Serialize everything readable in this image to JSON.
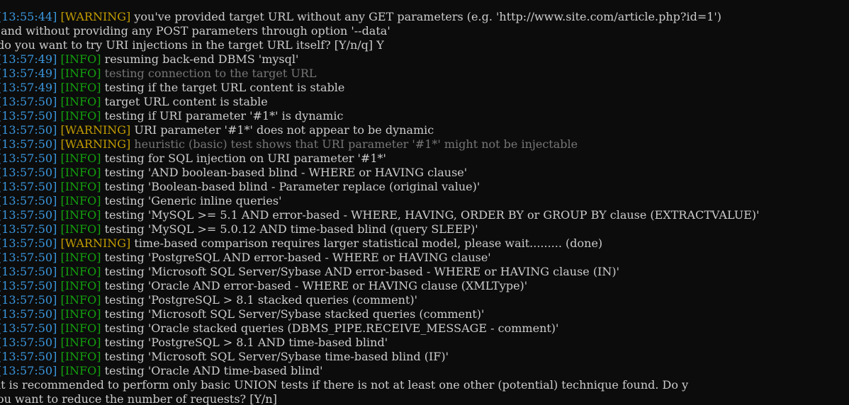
{
  "terminal": {
    "lines": [
      {
        "type": "log",
        "ts": "13:55:44",
        "level": "WARNING",
        "msg": "you've provided target URL without any GET parameters (e.g. 'http://www.site.com/article.php?id=1')",
        "dim": false
      },
      {
        "type": "plain",
        "text": " and without providing any POST parameters through option '--data'"
      },
      {
        "type": "plain",
        "text": "do you want to try URI injections in the target URL itself? [Y/n/q] Y"
      },
      {
        "type": "log",
        "ts": "13:57:49",
        "level": "INFO",
        "msg": "resuming back-end DBMS 'mysql'",
        "dim": false
      },
      {
        "type": "log",
        "ts": "13:57:49",
        "level": "INFO",
        "msg": "testing connection to the target URL",
        "dim": true
      },
      {
        "type": "log",
        "ts": "13:57:49",
        "level": "INFO",
        "msg": "testing if the target URL content is stable",
        "dim": false
      },
      {
        "type": "log",
        "ts": "13:57:50",
        "level": "INFO",
        "msg": "target URL content is stable",
        "dim": false
      },
      {
        "type": "log",
        "ts": "13:57:50",
        "level": "INFO",
        "msg": "testing if URI parameter '#1*' is dynamic",
        "dim": false
      },
      {
        "type": "log",
        "ts": "13:57:50",
        "level": "WARNING",
        "msg": "URI parameter '#1*' does not appear to be dynamic",
        "dim": false
      },
      {
        "type": "log",
        "ts": "13:57:50",
        "level": "WARNING",
        "msg": "heuristic (basic) test shows that URI parameter '#1*' might not be injectable",
        "dim": true
      },
      {
        "type": "log",
        "ts": "13:57:50",
        "level": "INFO",
        "msg": "testing for SQL injection on URI parameter '#1*'",
        "dim": false
      },
      {
        "type": "log",
        "ts": "13:57:50",
        "level": "INFO",
        "msg": "testing 'AND boolean-based blind - WHERE or HAVING clause'",
        "dim": false
      },
      {
        "type": "log",
        "ts": "13:57:50",
        "level": "INFO",
        "msg": "testing 'Boolean-based blind - Parameter replace (original value)'",
        "dim": false
      },
      {
        "type": "log",
        "ts": "13:57:50",
        "level": "INFO",
        "msg": "testing 'Generic inline queries'",
        "dim": false
      },
      {
        "type": "log",
        "ts": "13:57:50",
        "level": "INFO",
        "msg": "testing 'MySQL >= 5.1 AND error-based - WHERE, HAVING, ORDER BY or GROUP BY clause (EXTRACTVALUE)'",
        "dim": false
      },
      {
        "type": "log",
        "ts": "13:57:50",
        "level": "INFO",
        "msg": "testing 'MySQL >= 5.0.12 AND time-based blind (query SLEEP)'",
        "dim": false
      },
      {
        "type": "log",
        "ts": "13:57:50",
        "level": "WARNING",
        "msg": "time-based comparison requires larger statistical model, please wait......... (done)",
        "dim": false
      },
      {
        "type": "log",
        "ts": "13:57:50",
        "level": "INFO",
        "msg": "testing 'PostgreSQL AND error-based - WHERE or HAVING clause'",
        "dim": false
      },
      {
        "type": "log",
        "ts": "13:57:50",
        "level": "INFO",
        "msg": "testing 'Microsoft SQL Server/Sybase AND error-based - WHERE or HAVING clause (IN)'",
        "dim": false
      },
      {
        "type": "log",
        "ts": "13:57:50",
        "level": "INFO",
        "msg": "testing 'Oracle AND error-based - WHERE or HAVING clause (XMLType)'",
        "dim": false
      },
      {
        "type": "log",
        "ts": "13:57:50",
        "level": "INFO",
        "msg": "testing 'PostgreSQL > 8.1 stacked queries (comment)'",
        "dim": false
      },
      {
        "type": "log",
        "ts": "13:57:50",
        "level": "INFO",
        "msg": "testing 'Microsoft SQL Server/Sybase stacked queries (comment)'",
        "dim": false
      },
      {
        "type": "log",
        "ts": "13:57:50",
        "level": "INFO",
        "msg": "testing 'Oracle stacked queries (DBMS_PIPE.RECEIVE_MESSAGE - comment)'",
        "dim": false
      },
      {
        "type": "log",
        "ts": "13:57:50",
        "level": "INFO",
        "msg": "testing 'PostgreSQL > 8.1 AND time-based blind'",
        "dim": false
      },
      {
        "type": "log",
        "ts": "13:57:50",
        "level": "INFO",
        "msg": "testing 'Microsoft SQL Server/Sybase time-based blind (IF)'",
        "dim": false
      },
      {
        "type": "log",
        "ts": "13:57:50",
        "level": "INFO",
        "msg": "testing 'Oracle AND time-based blind'",
        "dim": false
      },
      {
        "type": "plain",
        "text": "it is recommended to perform only basic UNION tests if there is not at least one other (potential) technique found. Do y"
      },
      {
        "type": "plain",
        "text": "ou want to reduce the number of requests? [Y/n]"
      }
    ]
  },
  "colors": {
    "background": "#0c0c0c",
    "text": "#cccccc",
    "timestamp": "#3a96dd",
    "info": "#13a10e",
    "warning": "#c19c00",
    "dim": "#767676"
  }
}
